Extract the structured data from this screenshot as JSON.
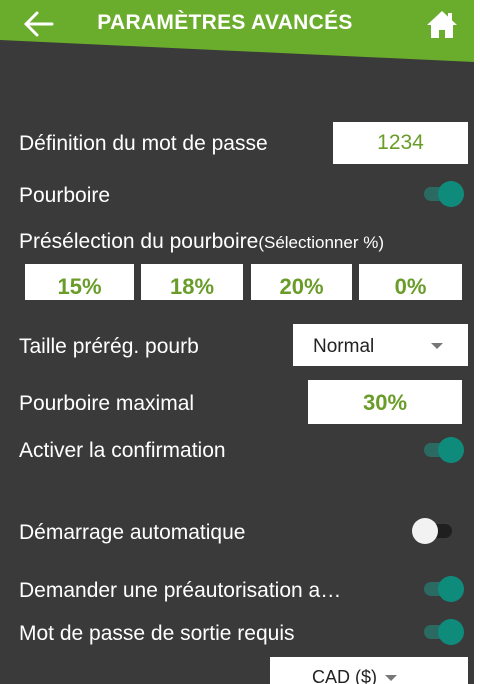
{
  "header": {
    "title": "PARAMÈTRES AVANCÉS",
    "accent_color": "#6aac2b",
    "back_icon": "arrow-left-icon",
    "home_icon": "home-icon"
  },
  "settings": {
    "password_label": "Définition du mot de passe",
    "password_value": "1234",
    "tip_label": "Pourboire",
    "tip_on": true,
    "preset_label": "Présélection du pourboire",
    "preset_hint": "(Sélectionner %)",
    "presets": [
      "15%",
      "18%",
      "20%",
      "0%"
    ],
    "preset_size_label": "Taille prérég. pourb",
    "preset_size_value": "Normal",
    "max_tip_label": "Pourboire maximal",
    "max_tip_value": "30%",
    "confirm_label": "Activer la confirmation",
    "confirm_on": true,
    "autostart_label": "Démarrage automatique",
    "autostart_on": false,
    "preauth_label": "Demander une préautorisation a…",
    "preauth_on": true,
    "exit_password_label": "Mot de passe de sortie requis",
    "exit_password_on": true,
    "currency_value": "CAD ($)"
  },
  "colors": {
    "background": "#3a3a3a",
    "field_text": "#6a9c2a",
    "toggle_on": "#0f8b7c"
  }
}
